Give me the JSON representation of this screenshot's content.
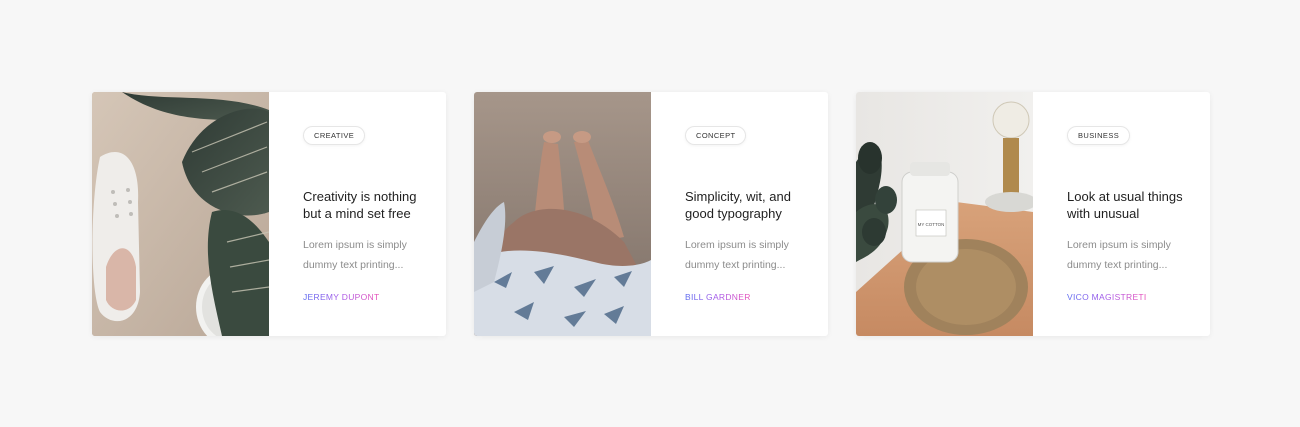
{
  "cards": [
    {
      "tag": "CREATIVE",
      "title": "Creativity is nothing but a mind set free",
      "excerpt": "Lorem ipsum is simply dummy text printing...",
      "author": "JEREMY DUPONT",
      "image": "sneaker-and-plant-photo"
    },
    {
      "tag": "CONCEPT",
      "title": "Simplicity, wit, and good typography",
      "excerpt": "Lorem ipsum is simply dummy text printing...",
      "author": "BILL GARDNER",
      "image": "feet-on-sand-photo"
    },
    {
      "tag": "BUSINESS",
      "title": "Look at usual things with unusual",
      "excerpt": "Lorem ipsum is simply dummy text printing...",
      "author": "VICO MAGISTRETI",
      "image": "candle-jar-and-lamp-photo",
      "jar_label": "MY COTTON"
    }
  ],
  "colors": {
    "background": "#f7f7f7",
    "card": "#ffffff",
    "author_gradient_start": "#5b6bf0",
    "author_gradient_end": "#ea4fb7"
  }
}
